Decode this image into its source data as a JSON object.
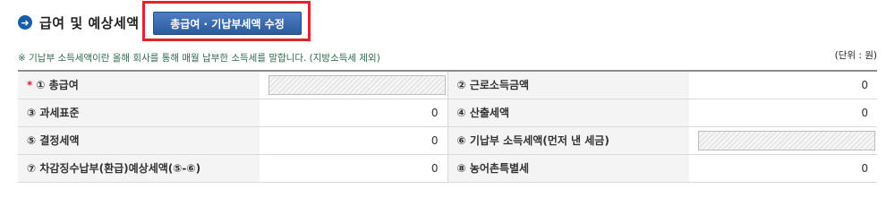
{
  "header": {
    "icon": "arrow-right-circle-icon",
    "title": "급여 및 예상세액",
    "edit_button": "총급여 · 기납부세액 수정"
  },
  "note": "※ 기납부 소득세액이란 올해 회사를 통해 매월 납부한 소득세를 말합니다. (지방소득세 제외)",
  "unit": "(단위 : 원)",
  "rows": [
    {
      "left_label": "① 총급여",
      "left_required": "*",
      "left_value": "",
      "right_label": "② 근로소득금액",
      "right_value": "0"
    },
    {
      "left_label": "③ 과세표준",
      "left_value": "0",
      "right_label": "④ 산출세액",
      "right_value": "0"
    },
    {
      "left_label": "⑤ 결정세액",
      "left_value": "0",
      "right_label": "⑥ 기납부 소득세액(먼저 낸 세금)",
      "right_value": ""
    },
    {
      "left_label": "⑦ 차감징수납부(환급)예상세액(⑤-⑥)",
      "left_value": "0",
      "right_label": "⑧ 농어촌특별세",
      "right_value": "0"
    }
  ],
  "colors": {
    "accent": "#1b5ea8",
    "highlight": "#e52229",
    "button": "#2c5a9c"
  }
}
